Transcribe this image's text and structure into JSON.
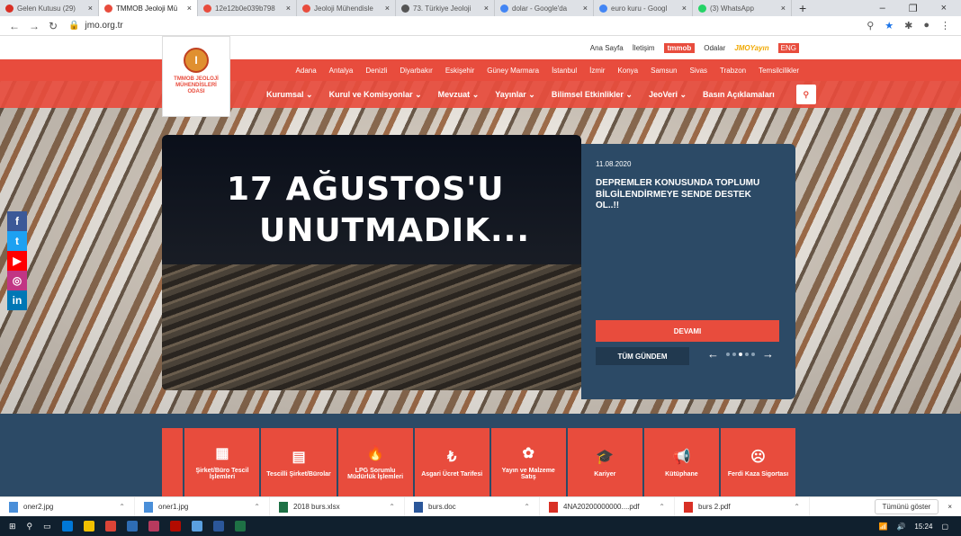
{
  "browser": {
    "tabs": [
      {
        "label": "Gelen Kutusu (29)",
        "color": "#d93025"
      },
      {
        "label": "TMMOB Jeoloji Mü",
        "color": "#e84c3d",
        "active": true
      },
      {
        "label": "12e12b0e039b798",
        "color": "#e84c3d"
      },
      {
        "label": "Jeoloji Mühendisle",
        "color": "#e84c3d"
      },
      {
        "label": "73. Türkiye Jeoloji",
        "color": "#555555"
      },
      {
        "label": "dolar - Google'da",
        "color": "#4285f4"
      },
      {
        "label": "euro kuru - Googl",
        "color": "#4285f4"
      },
      {
        "label": "(3) WhatsApp",
        "color": "#25d366"
      }
    ],
    "url": "jmo.org.tr",
    "close_glyph": "×",
    "newtab_glyph": "+"
  },
  "site": {
    "topbar": {
      "home": "Ana Sayfa",
      "contact": "İletişim",
      "tmmob": "tmmob",
      "odalar": "Odalar",
      "yayin": "JMOYayın",
      "eng": "ENG"
    },
    "cities": [
      "Adana",
      "Antalya",
      "Denizli",
      "Diyarbakır",
      "Eskişehir",
      "Güney Marmara",
      "İstanbul",
      "İzmir",
      "Konya",
      "Samsun",
      "Sivas",
      "Trabzon",
      "Temsilcilikler"
    ],
    "nav": [
      "Kurumsal",
      "Kurul ve Komisyonlar",
      "Mevzuat",
      "Yayınlar",
      "Bilimsel Etkinlikler",
      "JeoVeri",
      "Basın Açıklamaları"
    ],
    "logo_text": "TMMOB JEOLOJİ MÜHENDİSLERİ ODASI",
    "slide": {
      "line1": "17 AĞUSTOS'U",
      "line2": "UNUTMADIK..."
    },
    "news": {
      "date": "11.08.2020",
      "headline": "DEPREMLER KONUSUNDA TOPLUMU BİLGİLENDİRMEYE SENDE DESTEK OL..!!",
      "more": "DEVAMI",
      "all": "TÜM GÜNDEM"
    },
    "social": [
      {
        "label": "f",
        "color": "#3b5998"
      },
      {
        "label": "t",
        "color": "#1da1f2"
      },
      {
        "label": "▶",
        "color": "#ff0000"
      },
      {
        "label": "◎",
        "color": "#c13584"
      },
      {
        "label": "in",
        "color": "#0077b5"
      }
    ],
    "cards": [
      {
        "label": "Şirket/Büro Tescil İşlemleri",
        "icon": "▦"
      },
      {
        "label": "Tescilli Şirket/Bürolar",
        "icon": "▤"
      },
      {
        "label": "LPG Sorumlu Müdürlük İşlemleri",
        "icon": "🔥"
      },
      {
        "label": "Asgari Ücret Tarifesi",
        "icon": "₺"
      },
      {
        "label": "Yayın ve Malzeme Satış",
        "icon": "✿"
      },
      {
        "label": "Kariyer",
        "icon": "🎓"
      },
      {
        "label": "Kütüphane",
        "icon": "📢"
      },
      {
        "label": "Ferdi Kaza Sigortası",
        "icon": "☹"
      }
    ]
  },
  "downloads": {
    "items": [
      {
        "name": "oner2.jpg",
        "color": "#4a8fd9"
      },
      {
        "name": "oner1.jpg",
        "color": "#4a8fd9"
      },
      {
        "name": "2018 burs.xlsx",
        "color": "#1e7145"
      },
      {
        "name": "burs.doc",
        "color": "#2b579a"
      },
      {
        "name": "4NA20200000000....pdf",
        "color": "#d93025"
      },
      {
        "name": "burs 2.pdf",
        "color": "#d93025"
      }
    ],
    "show_all": "Tümünü göster"
  },
  "taskbar": {
    "clock": "15:24"
  }
}
